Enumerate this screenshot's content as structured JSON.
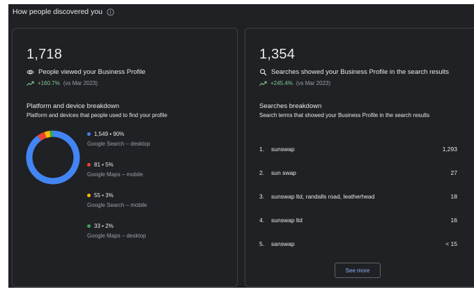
{
  "header": {
    "title": "How people discovered you",
    "info_icon": "info-icon"
  },
  "profile_views": {
    "value": "1,718",
    "label": "People viewed your Business Profile",
    "trend_pct": "+160.7%",
    "trend_vs": "(vs Mar 2023)"
  },
  "platform": {
    "title": "Platform and device breakdown",
    "description": "Platform and devices that people used to find your profile",
    "segments": [
      {
        "value_label": "1,549 • 90%",
        "name": "Google Search – desktop",
        "value": 1549,
        "color": "#4285f4"
      },
      {
        "value_label": "81 • 5%",
        "name": "Google Maps – mobile",
        "value": 81,
        "color": "#ea4335"
      },
      {
        "value_label": "55 • 3%",
        "name": "Google Search – mobile",
        "value": 55,
        "color": "#fbbc04"
      },
      {
        "value_label": "33 • 2%",
        "name": "Google Maps – desktop",
        "value": 33,
        "color": "#34a853"
      }
    ]
  },
  "searches": {
    "value": "1,354",
    "label": "Searches showed your Business Profile in the search results",
    "trend_pct": "+245.4%",
    "trend_vs": "(vs Mar 2023)",
    "breakdown_title": "Searches breakdown",
    "breakdown_desc": "Search terms that showed your Business Profile in the search results",
    "items": [
      {
        "num": "1.",
        "term": "sunswap",
        "count": "1,293"
      },
      {
        "num": "2.",
        "term": "sun swap",
        "count": "27"
      },
      {
        "num": "3.",
        "term": "sunswap ltd, randalls road, leatherhead",
        "count": "18"
      },
      {
        "num": "4.",
        "term": "sunswap ltd",
        "count": "16"
      },
      {
        "num": "5.",
        "term": "sanswap",
        "count": "< 15"
      }
    ],
    "see_more_label": "See more"
  }
}
